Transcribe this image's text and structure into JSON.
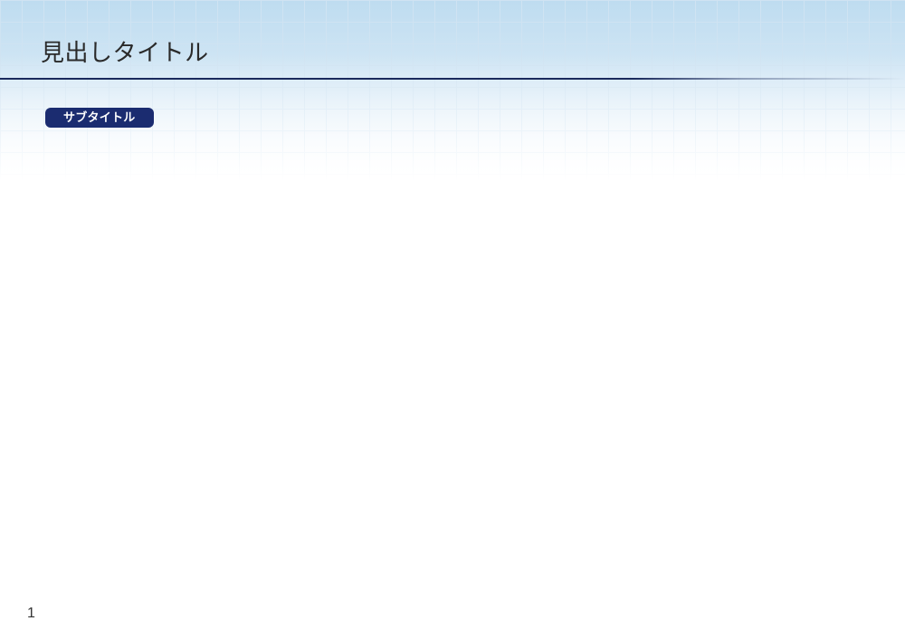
{
  "title": "見出しタイトル",
  "subtitle": "サブタイトル",
  "page_number": "1",
  "colors": {
    "rule": "#1a2a5c",
    "pill_bg": "#1b2c70",
    "pill_text": "#ffffff",
    "grid_light": "#cfe3f2",
    "grid_bg_top": "#bedcf0"
  }
}
